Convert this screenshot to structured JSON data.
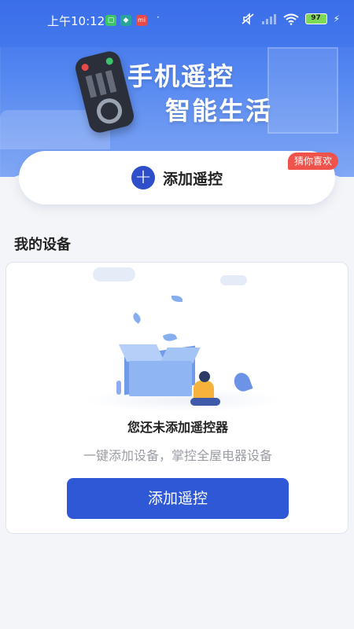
{
  "status_bar": {
    "time": "上午10:12",
    "app_icons": [
      {
        "name": "message-app-icon",
        "glyph": "▢",
        "color": "#3cc46b"
      },
      {
        "name": "shield-app-icon",
        "glyph": "◆",
        "color": "#26a69a"
      },
      {
        "name": "mi-app-icon",
        "glyph": "mi",
        "color": "#e84a4a"
      }
    ],
    "dot": "·",
    "battery_level": "97"
  },
  "banner": {
    "slogan_line1": "手机遥控",
    "slogan_line2": "智能生活"
  },
  "add_remote_card": {
    "label": "添加遥控",
    "plus_glyph": "+",
    "badge": "猜你喜欢"
  },
  "my_devices": {
    "title": "我的设备",
    "empty_title": "您还未添加遥控器",
    "empty_subtitle": "一键添加设备，掌控全屋电器设备",
    "add_button_label": "添加遥控"
  },
  "colors": {
    "primary": "#2e58d6",
    "badge": "#f0534b",
    "banner": "#4a80f0"
  }
}
